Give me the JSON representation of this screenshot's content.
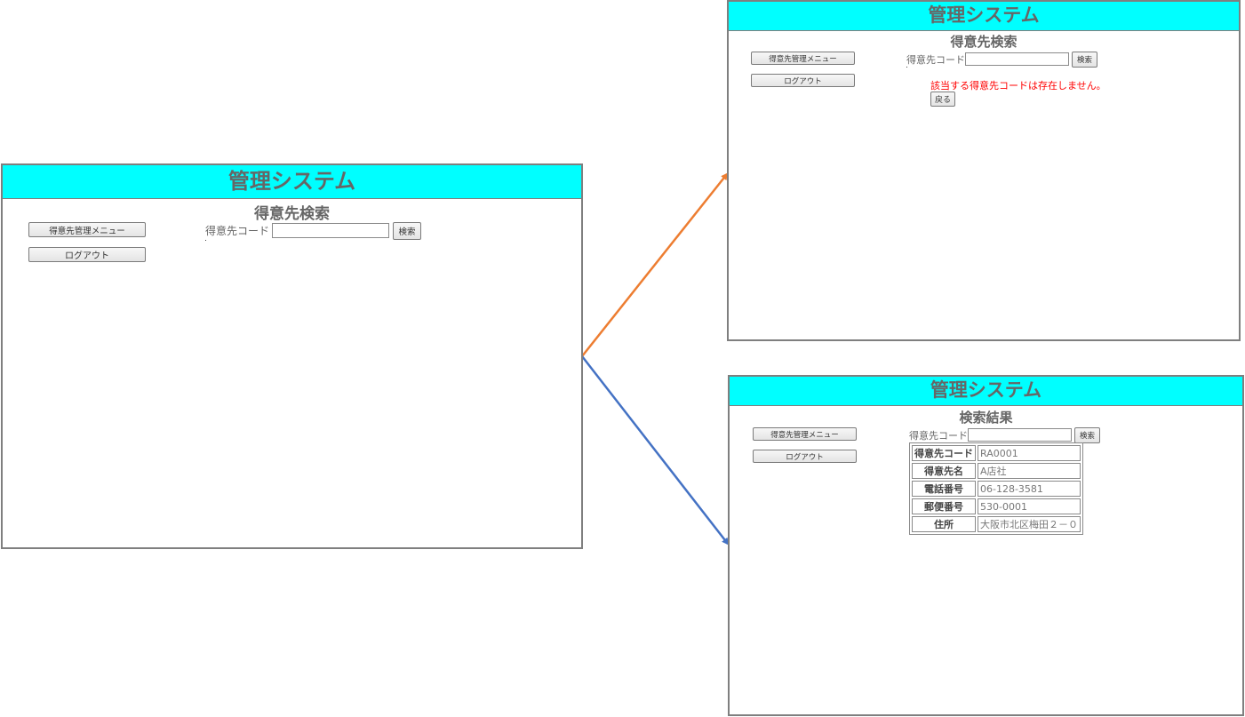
{
  "app_title": "管理システム",
  "buttons": {
    "customer_menu": "得意先管理メニュー",
    "logout": "ログアウト",
    "search": "検索",
    "back": "戻る"
  },
  "search_screen": {
    "title": "得意先検索",
    "code_label": "得意先コード",
    "code_value": ""
  },
  "error_screen": {
    "title": "得意先検索",
    "message": "該当する得意先コードは存在しません。"
  },
  "result_screen": {
    "title": "検索結果",
    "rows": [
      {
        "label": "得意先コード",
        "value": "RA0001"
      },
      {
        "label": "得意先名",
        "value": "A店社"
      },
      {
        "label": "電話番号",
        "value": "06-128-3581"
      },
      {
        "label": "郵便番号",
        "value": "530-0001"
      },
      {
        "label": "住所",
        "value": "大阪市北区梅田２－０"
      }
    ]
  },
  "colors": {
    "header_bg": "#00ffff",
    "arrow_error": "#ed7d31",
    "arrow_result": "#4472c4",
    "error_text": "#ff0000"
  }
}
